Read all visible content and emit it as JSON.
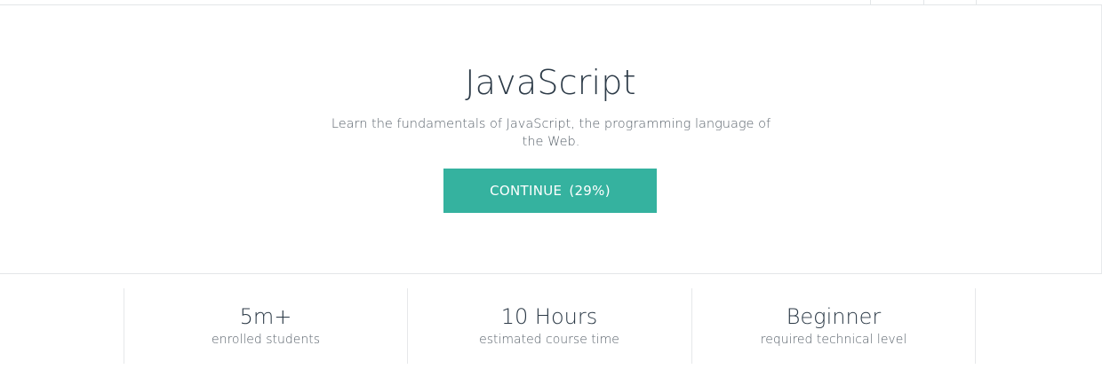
{
  "course": {
    "title": "JavaScript",
    "description": "Learn the fundamentals of JavaScript, the programming language of the Web.",
    "continue_label": "CONTINUE",
    "progress_text": "(29%)",
    "progress_percent": 29,
    "accent_color": "#35b29f"
  },
  "stats": [
    {
      "value": "5m+",
      "label": "enrolled students"
    },
    {
      "value": "10 Hours",
      "label": "estimated course time"
    },
    {
      "value": "Beginner",
      "label": "required technical level"
    }
  ]
}
